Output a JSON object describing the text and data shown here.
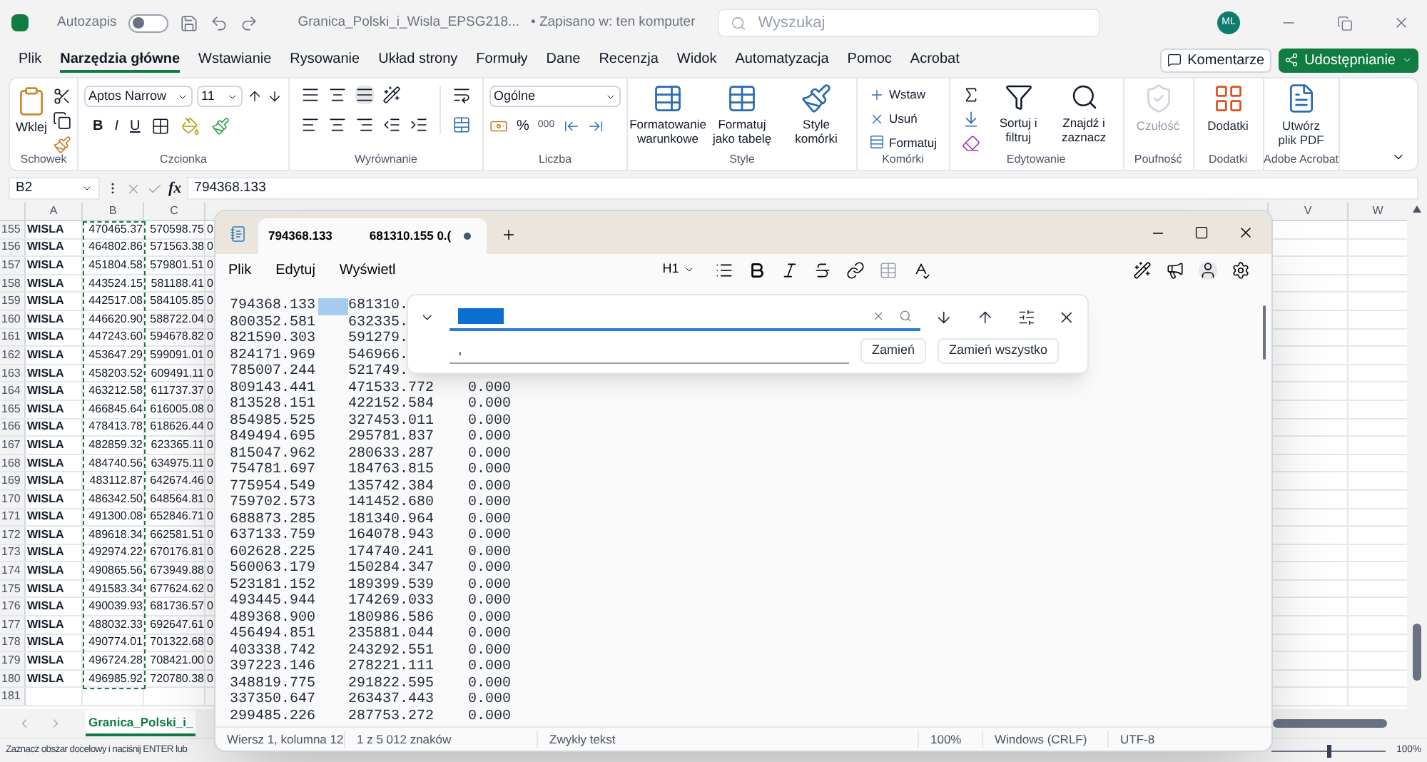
{
  "excel": {
    "title_bar": {
      "autosave_label": "Autozapis",
      "autosave_on": false,
      "file_name": "Granica_Polski_i_Wisla_EPSG218...",
      "save_status": "• Zapisano w: ten komputer",
      "search_placeholder": "Wyszukaj",
      "avatar": "ML"
    },
    "menu_tabs": [
      {
        "label": "Plik",
        "selected": false
      },
      {
        "label": "Narzędzia główne",
        "selected": true
      },
      {
        "label": "Wstawianie",
        "selected": false
      },
      {
        "label": "Rysowanie",
        "selected": false
      },
      {
        "label": "Układ strony",
        "selected": false
      },
      {
        "label": "Formuły",
        "selected": false
      },
      {
        "label": "Dane",
        "selected": false
      },
      {
        "label": "Recenzja",
        "selected": false
      },
      {
        "label": "Widok",
        "selected": false
      },
      {
        "label": "Automatyzacja",
        "selected": false
      },
      {
        "label": "Pomoc",
        "selected": false
      },
      {
        "label": "Acrobat",
        "selected": false
      }
    ],
    "comments_button": "Komentarze",
    "share_button": "Udostępnianie",
    "ribbon": [
      {
        "kind": "clipboard",
        "label": "Schowek",
        "paste": "Wklej"
      },
      {
        "kind": "font",
        "label": "Czcionka",
        "font": "Aptos Narrow",
        "size": "11",
        "bold": "B",
        "italic": "I",
        "underline": "U"
      },
      {
        "kind": "alignment",
        "label": "Wyrównanie"
      },
      {
        "kind": "number",
        "label": "Liczba",
        "format": "Ogólne",
        "percent": "%",
        "thousands": "000"
      },
      {
        "kind": "styles",
        "label": "Style",
        "items": [
          "Formatowanie warunkowe",
          "Formatuj jako tabelę",
          "Style komórki"
        ]
      },
      {
        "kind": "cells",
        "label": "Komórki",
        "items": [
          "Wstaw",
          "Usuń",
          "Formatuj"
        ]
      },
      {
        "kind": "editing",
        "label": "Edytowanie",
        "items": [
          "Sortuj i filtruj",
          "Znajdź i zaznacz"
        ]
      },
      {
        "kind": "sensitivity",
        "label": "Poufność",
        "button": "Czułość",
        "disabled": true
      },
      {
        "kind": "addins",
        "label": "Dodatki",
        "button": "Dodatki",
        "disabled": false
      },
      {
        "kind": "pdf",
        "label": "Adobe Acrobat",
        "button": "Utwórz plik PDF",
        "disabled": false
      }
    ],
    "formula_bar": {
      "name_box": "B2",
      "fx": "fx",
      "value": "794368.133"
    },
    "columns": [
      "A",
      "B",
      "C",
      "V",
      "W"
    ],
    "rows": [
      {
        "number": "155",
        "a": "WISLA",
        "b": "470465.37",
        "c": "570598.75",
        "d": "0"
      },
      {
        "number": "156",
        "a": "WISLA",
        "b": "464802.86",
        "c": "571563.38",
        "d": "0"
      },
      {
        "number": "157",
        "a": "WISLA",
        "b": "451804.58",
        "c": "579801.51",
        "d": "0"
      },
      {
        "number": "158",
        "a": "WISLA",
        "b": "443524.15",
        "c": "581188.41",
        "d": "0"
      },
      {
        "number": "159",
        "a": "WISLA",
        "b": "442517.08",
        "c": "584105.85",
        "d": "0"
      },
      {
        "number": "160",
        "a": "WISLA",
        "b": "446620.90",
        "c": "588722.04",
        "d": "0"
      },
      {
        "number": "161",
        "a": "WISLA",
        "b": "447243.60",
        "c": "594678.82",
        "d": "0"
      },
      {
        "number": "162",
        "a": "WISLA",
        "b": "453647.29",
        "c": "599091.01",
        "d": "0"
      },
      {
        "number": "163",
        "a": "WISLA",
        "b": "458203.52",
        "c": "609491.11",
        "d": "0"
      },
      {
        "number": "164",
        "a": "WISLA",
        "b": "463212.58",
        "c": "611737.37",
        "d": "0"
      },
      {
        "number": "165",
        "a": "WISLA",
        "b": "466845.64",
        "c": "616005.08",
        "d": "0"
      },
      {
        "number": "166",
        "a": "WISLA",
        "b": "478413.78",
        "c": "618626.44",
        "d": "0"
      },
      {
        "number": "167",
        "a": "WISLA",
        "b": "482859.32",
        "c": "623365.11",
        "d": "0"
      },
      {
        "number": "168",
        "a": "WISLA",
        "b": "484740.56",
        "c": "634975.11",
        "d": "0"
      },
      {
        "number": "169",
        "a": "WISLA",
        "b": "483112.87",
        "c": "642674.46",
        "d": "0"
      },
      {
        "number": "170",
        "a": "WISLA",
        "b": "486342.50",
        "c": "648564.81",
        "d": "0"
      },
      {
        "number": "171",
        "a": "WISLA",
        "b": "491300.08",
        "c": "652846.71",
        "d": "0"
      },
      {
        "number": "172",
        "a": "WISLA",
        "b": "489618.34",
        "c": "662581.51",
        "d": "0"
      },
      {
        "number": "173",
        "a": "WISLA",
        "b": "492974.22",
        "c": "670176.81",
        "d": "0"
      },
      {
        "number": "174",
        "a": "WISLA",
        "b": "490865.56",
        "c": "673949.88",
        "d": "0"
      },
      {
        "number": "175",
        "a": "WISLA",
        "b": "491583.34",
        "c": "677624.62",
        "d": "0"
      },
      {
        "number": "176",
        "a": "WISLA",
        "b": "490039.93",
        "c": "681736.57",
        "d": "0"
      },
      {
        "number": "177",
        "a": "WISLA",
        "b": "488032.33",
        "c": "692647.61",
        "d": "0"
      },
      {
        "number": "178",
        "a": "WISLA",
        "b": "490774.01",
        "c": "701322.68",
        "d": "0"
      },
      {
        "number": "179",
        "a": "WISLA",
        "b": "496724.28",
        "c": "708421.00",
        "d": "0"
      },
      {
        "number": "180",
        "a": "WISLA",
        "b": "496985.92",
        "c": "720780.38",
        "d": "0"
      },
      {
        "number": "181"
      }
    ],
    "sheet_tab": "Granica_Polski_i_",
    "status": "Zaznacz obszar docelowy i naciśnij ENTER lub",
    "zoom_slider": {
      "level": 0.5
    },
    "zoom": "100%"
  },
  "notepad": {
    "tab": {
      "title": "794368.133",
      "title_rest": "681310.155 0.(",
      "unsaved": true
    },
    "menu": [
      "Plik",
      "Edytuj",
      "Wyświetl"
    ],
    "heading_button": "H1",
    "tab_char_selected": true,
    "lines": [
      {
        "cells": [
          "794368.133",
          "681310."
        ]
      },
      {
        "cells": [
          "800352.581",
          "632335."
        ]
      },
      {
        "cells": [
          "821590.303",
          "591279."
        ]
      },
      {
        "cells": [
          "824171.969",
          "546966."
        ]
      },
      {
        "cells": [
          "785007.244",
          "521749."
        ]
      },
      {
        "cells": [
          "809143.441",
          "471533.772",
          "0.000"
        ]
      },
      {
        "cells": [
          "813528.151",
          "422152.584",
          "0.000"
        ]
      },
      {
        "cells": [
          "854985.525",
          "327453.011",
          "0.000"
        ]
      },
      {
        "cells": [
          "849494.695",
          "295781.837",
          "0.000"
        ]
      },
      {
        "cells": [
          "815047.962",
          "280633.287",
          "0.000"
        ]
      },
      {
        "cells": [
          "754781.697",
          "184763.815",
          "0.000"
        ]
      },
      {
        "cells": [
          "775954.549",
          "135742.384",
          "0.000"
        ]
      },
      {
        "cells": [
          "759702.573",
          "141452.680",
          "0.000"
        ]
      },
      {
        "cells": [
          "688873.285",
          "181340.964",
          "0.000"
        ]
      },
      {
        "cells": [
          "637133.759",
          "164078.943",
          "0.000"
        ]
      },
      {
        "cells": [
          "602628.225",
          "174740.241",
          "0.000"
        ]
      },
      {
        "cells": [
          "560063.179",
          "150284.347",
          "0.000"
        ]
      },
      {
        "cells": [
          "523181.152",
          "189399.539",
          "0.000"
        ]
      },
      {
        "cells": [
          "493445.944",
          "174269.033",
          "0.000"
        ]
      },
      {
        "cells": [
          "489368.900",
          "180986.586",
          "0.000"
        ]
      },
      {
        "cells": [
          "456494.851",
          "235881.044",
          "0.000"
        ]
      },
      {
        "cells": [
          "403338.742",
          "243292.551",
          "0.000"
        ]
      },
      {
        "cells": [
          "397223.146",
          "278221.111",
          "0.000"
        ]
      },
      {
        "cells": [
          "348819.775",
          "291822.595",
          "0.000"
        ]
      },
      {
        "cells": [
          "337350.647",
          "263437.443",
          "0.000"
        ]
      },
      {
        "cells": [
          "299485.226",
          "287753.272",
          "0.000"
        ]
      }
    ],
    "find": {
      "find_selected": true,
      "replace_value": ",",
      "buttons": [
        "Zamień",
        "Zamień wszystko"
      ]
    },
    "status_bar": [
      "Wiersz 1, kolumna 12",
      "1 z 5 012 znaków",
      "Zwykły tekst",
      "100%",
      "Windows (CRLF)",
      "UTF-8"
    ]
  }
}
